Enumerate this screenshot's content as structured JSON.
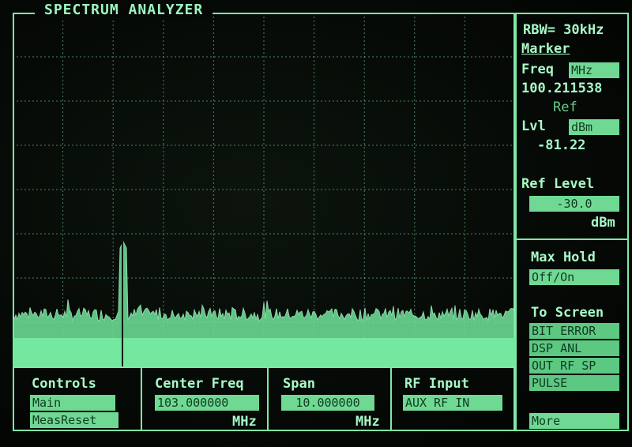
{
  "app": {
    "title": "SPECTRUM ANALYZER"
  },
  "side": {
    "rbw": "RBW= 30kHz",
    "marker_label": "Marker",
    "freq_label": "Freq",
    "freq_unit": "MHz",
    "freq_value": "100.211538",
    "ref_label": "Ref",
    "lvl_label": "Lvl",
    "lvl_unit": "dBm",
    "lvl_value": "-81.22",
    "ref_level_label": "Ref Level",
    "ref_level_value": "-30.0",
    "ref_level_unit": "dBm",
    "max_hold_label": "Max Hold",
    "max_hold_value": "Off/On",
    "to_screen_label": "To Screen",
    "to_screen_items": [
      "BIT ERROR",
      "DSP ANL",
      "OUT RF SP",
      "PULSE"
    ],
    "more_label": "More"
  },
  "softkeys": {
    "controls_label": "Controls",
    "controls_items": [
      "Main",
      "MeasReset"
    ],
    "center_freq_label": "Center Freq",
    "center_freq_value": "103.000000",
    "center_freq_unit": "MHz",
    "span_label": "Span",
    "span_value": "10.000000",
    "span_unit": "MHz",
    "rf_input_label": "RF Input",
    "rf_input_value": "AUX RF IN"
  },
  "colors": {
    "phosphor": "#7fe8a6",
    "field": "#6fd994",
    "background": "#050805"
  }
}
